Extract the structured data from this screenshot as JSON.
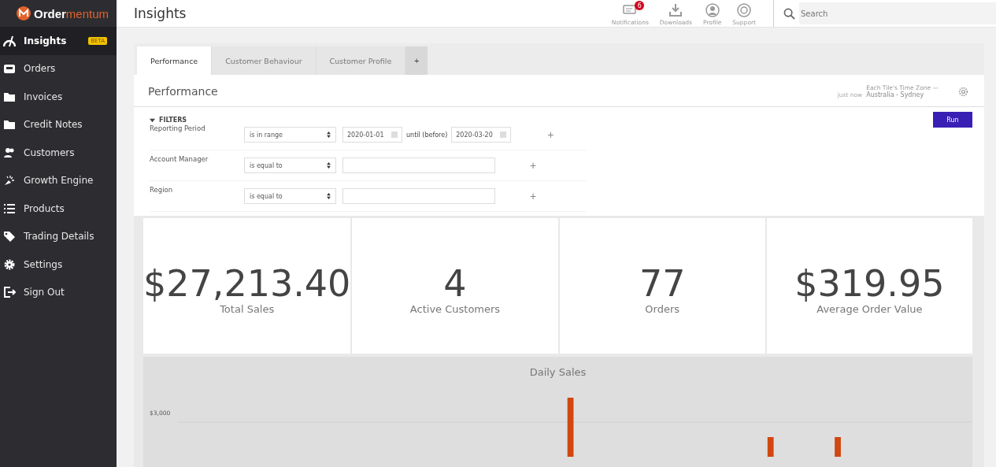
{
  "brand": {
    "first": "Order",
    "second": "mentum"
  },
  "sidebar": {
    "items": [
      {
        "label": "Insights",
        "selected": true,
        "badge": "BETA"
      },
      {
        "label": "Orders",
        "selected": false
      },
      {
        "label": "Invoices",
        "selected": false
      },
      {
        "label": "Credit Notes",
        "selected": false
      },
      {
        "label": "Customers",
        "selected": false
      },
      {
        "label": "Growth Engine",
        "selected": false
      },
      {
        "label": "Products",
        "selected": false
      },
      {
        "label": "Trading Details",
        "selected": false
      },
      {
        "label": "Settings",
        "selected": false
      },
      {
        "label": "Sign Out",
        "selected": false
      }
    ]
  },
  "header": {
    "title": "Insights",
    "actions": [
      {
        "label": "Notifications",
        "badge": "6"
      },
      {
        "label": "Downloads"
      },
      {
        "label": "Profile"
      },
      {
        "label": "Support"
      }
    ],
    "search": {
      "placeholder": "Search"
    }
  },
  "tabs": [
    {
      "label": "Performance",
      "selected": true
    },
    {
      "label": "Customer Behaviour",
      "selected": false
    },
    {
      "label": "Customer Profile",
      "selected": false
    }
  ],
  "add_tab": "+",
  "panel": {
    "title": "Performance",
    "updated": "just now",
    "timezone_label": "Each Tile's Time Zone —",
    "timezone": "Australia - Sydney",
    "filters_label": "FILTERS",
    "filters_expanded": true,
    "run": "Run",
    "filters": [
      {
        "kind": "range",
        "label": "Reporting Period",
        "operator": "is in range",
        "from": "2020-01-01",
        "between": "until (before)",
        "to": "2020-03-20",
        "add": "+"
      },
      {
        "kind": "value",
        "label": "Account Manager",
        "operator": "is equal to",
        "add": "+"
      },
      {
        "kind": "value",
        "label": "Region",
        "operator": "is equal to",
        "add": "+"
      }
    ]
  },
  "stats": [
    {
      "value": "$27,213.40",
      "label": "Total Sales"
    },
    {
      "value": "4",
      "label": "Active Customers"
    },
    {
      "value": "77",
      "label": "Orders"
    },
    {
      "value": "$319.95",
      "label": "Average Order Value"
    }
  ],
  "daily_sales": {
    "title": "Daily Sales",
    "tick_label": "$3,000"
  }
}
